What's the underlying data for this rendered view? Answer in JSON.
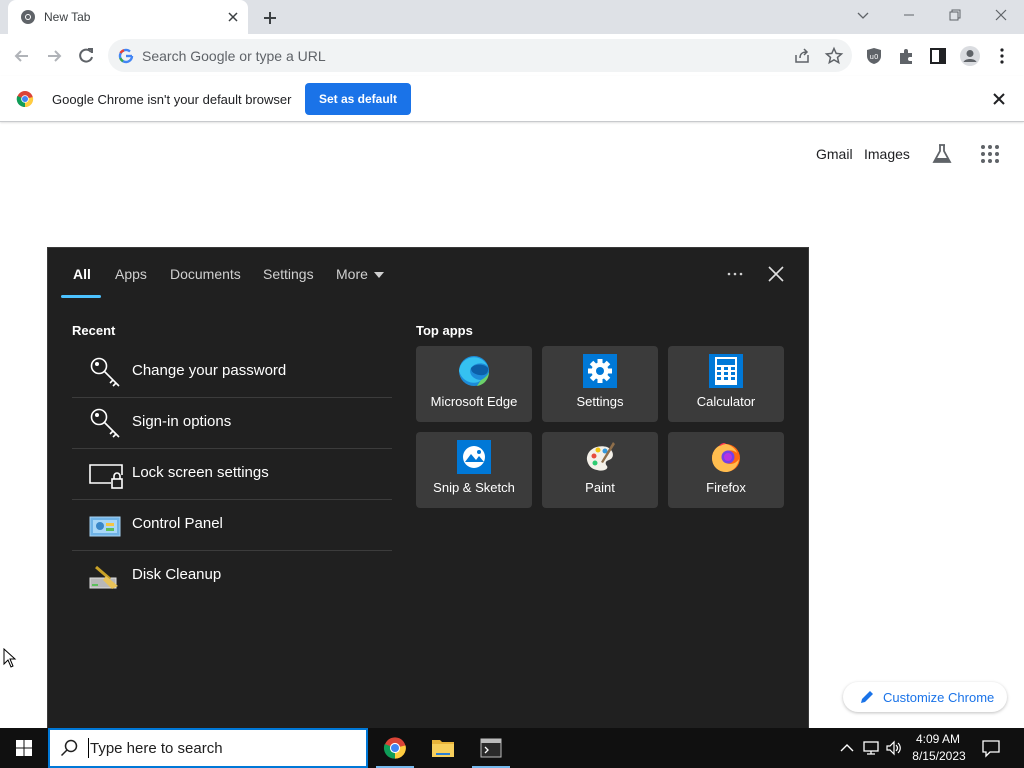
{
  "browser": {
    "tab_title": "New Tab",
    "omnibox_placeholder": "Search Google or type a URL",
    "infobar_text": "Google Chrome isn't your default browser",
    "infobar_button": "Set as default"
  },
  "ntp": {
    "gmail": "Gmail",
    "images": "Images",
    "customize": "Customize Chrome"
  },
  "search_panel": {
    "tabs": [
      "All",
      "Apps",
      "Documents",
      "Settings",
      "More"
    ],
    "recent_heading": "Recent",
    "recent": [
      {
        "label": "Change your password",
        "icon": "key-icon"
      },
      {
        "label": "Sign-in options",
        "icon": "key-icon"
      },
      {
        "label": "Lock screen settings",
        "icon": "lock-screen-icon"
      },
      {
        "label": "Control Panel",
        "icon": "control-panel-icon"
      },
      {
        "label": "Disk Cleanup",
        "icon": "disk-cleanup-icon"
      }
    ],
    "top_apps_heading": "Top apps",
    "apps": [
      {
        "label": "Microsoft Edge",
        "icon": "edge-icon"
      },
      {
        "label": "Settings",
        "icon": "settings-gear-icon"
      },
      {
        "label": "Calculator",
        "icon": "calculator-icon"
      },
      {
        "label": "Snip & Sketch",
        "icon": "snip-sketch-icon"
      },
      {
        "label": "Paint",
        "icon": "paint-icon"
      },
      {
        "label": "Firefox",
        "icon": "firefox-icon"
      }
    ]
  },
  "taskbar": {
    "search_placeholder": "Type here to search",
    "time": "4:09 AM",
    "date": "8/15/2023"
  },
  "colors": {
    "chrome_blue": "#1a73e8",
    "panel_bg": "#202020",
    "tile_bg": "#3b3b3b",
    "accent": "#4cc2ff",
    "taskbar_bg": "#101010"
  }
}
